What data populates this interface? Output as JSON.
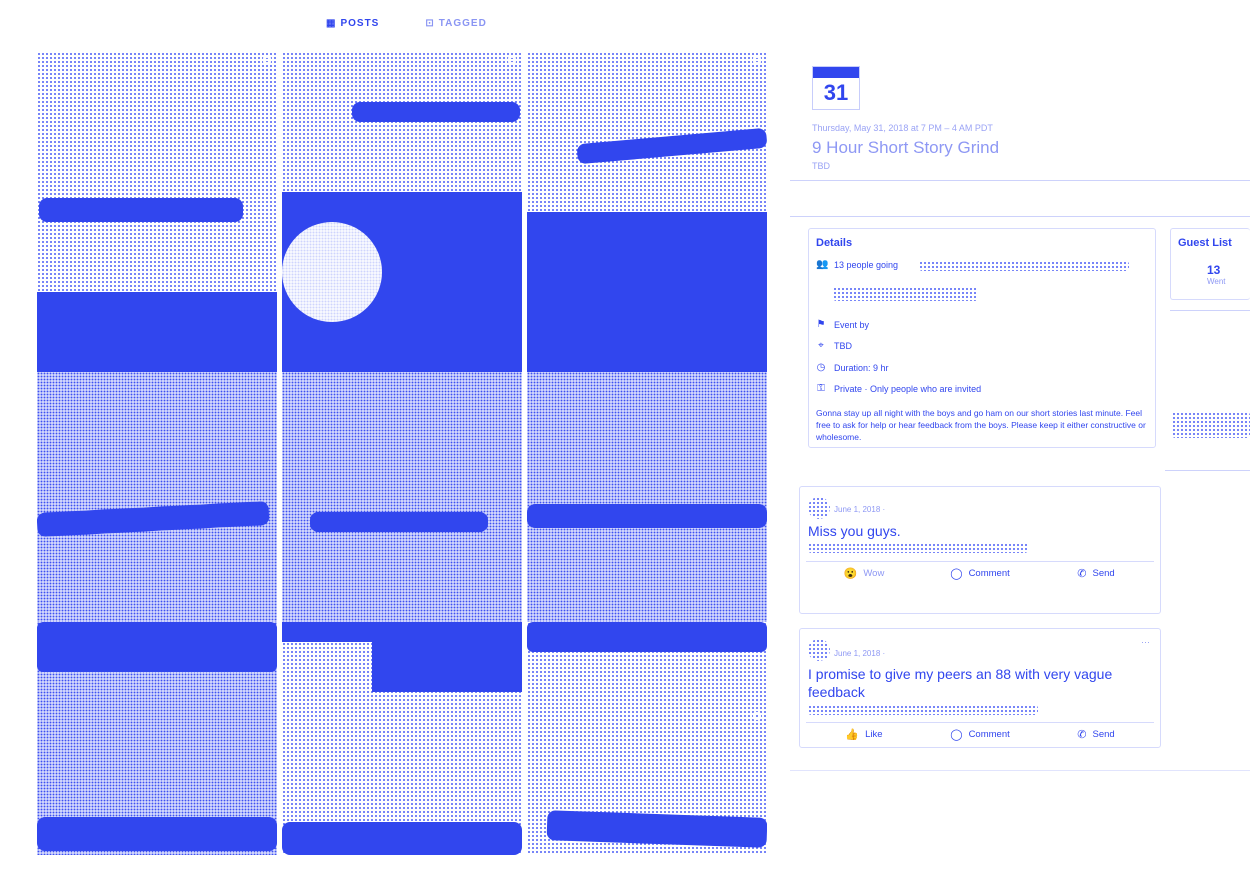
{
  "tabs": [
    {
      "icon": "grid-icon",
      "label": "POSTS",
      "active": true
    },
    {
      "icon": "tag-icon",
      "label": "TAGGED",
      "active": false
    }
  ],
  "event": {
    "day": "31",
    "date_line": "Thursday, May 31, 2018 at 7 PM – 4 AM PDT",
    "title": "9 Hour Short Story Grind",
    "location": "TBD"
  },
  "details": {
    "heading": "Details",
    "going": "13 people going",
    "event_by": "Event by",
    "location": "TBD",
    "duration": "Duration: 9 hr",
    "privacy": "Private · Only people who are invited",
    "description": "Gonna stay up all night with the boys and go ham on our short stories last minute. Feel free to ask for help or hear feedback from the boys. Please keep it either constructive or wholesome."
  },
  "guest_list": {
    "heading": "Guest List",
    "count": "13",
    "label": "Went"
  },
  "posts": [
    {
      "date": "June 1, 2018 · ",
      "text": "Miss you guys.",
      "actions": [
        {
          "icon": "wow-icon",
          "label": "Wow"
        },
        {
          "icon": "comment-icon",
          "label": "Comment"
        },
        {
          "icon": "send-icon",
          "label": "Send"
        }
      ]
    },
    {
      "date": "June 1, 2018 · ",
      "text": "I promise to give my peers an 88 with very vague feedback",
      "more": "···",
      "actions": [
        {
          "icon": "like-icon",
          "label": "Like"
        },
        {
          "icon": "comment-icon",
          "label": "Comment"
        },
        {
          "icon": "send-icon",
          "label": "Send"
        }
      ]
    }
  ],
  "colors": {
    "accent": "#3146ee",
    "muted": "#8e98f4",
    "border": "#d6dafc"
  }
}
